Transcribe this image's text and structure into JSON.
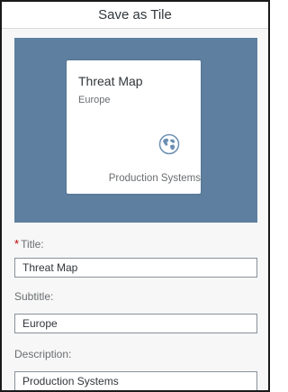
{
  "dialog": {
    "title": "Save as Tile"
  },
  "tile_preview": {
    "title": "Threat Map",
    "subtitle": "Europe",
    "icon": "globe-icon",
    "footer": "Production Systems",
    "background_color": "#5e7f9f"
  },
  "form": {
    "title_label": "Title:",
    "required_marker": "*",
    "title_value": "Threat Map",
    "subtitle_label": "Subtitle:",
    "subtitle_value": "Europe",
    "description_label": "Description:",
    "description_value": "Production Systems"
  },
  "colors": {
    "required": "#bb0000",
    "accent": "#5e7f9f"
  }
}
